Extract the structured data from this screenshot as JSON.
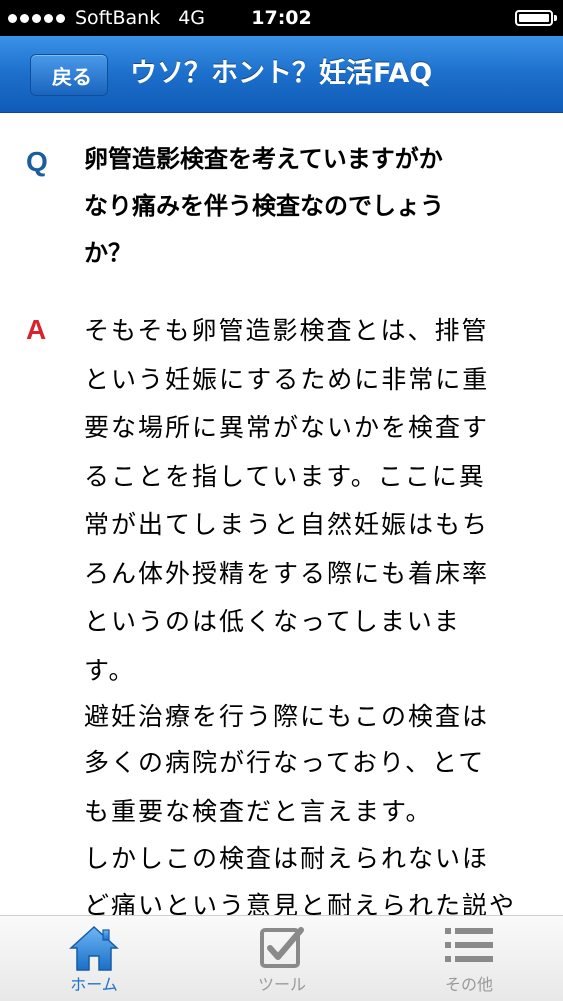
{
  "status_bar": {
    "carrier": "SoftBank",
    "network": "4G",
    "time": "17:02"
  },
  "navbar": {
    "back_label": "戻る",
    "title": "ウソ？ホント？妊活FAQ"
  },
  "qa": {
    "q_mark": "Q",
    "question_lines": [
      "卵管造影検査を考えていますがか",
      "なり痛みを伴う検査なのでしょう",
      "か？"
    ],
    "a_mark": "A",
    "answer_lines": [
      "そもそも卵管造影検査とは、排管",
      "という妊娠にするために非常に重",
      "要な場所に異常がないかを検査す",
      "ることを指しています。ここに異",
      "常が出てしまうと自然妊娠はもち",
      "ろん体外授精をする際にも着床率",
      "というのは低くなってしまいま",
      "す。",
      "避妊治療を行う際にもこの検査は",
      "多くの病院が行なっており、とて",
      "も重要な検査だと言えます。",
      "しかしこの検査は耐えられないほ",
      "ど痛いという意見と耐えられた説や"
    ]
  },
  "tabbar": {
    "tabs": [
      {
        "label": "ホーム",
        "icon": "house-icon",
        "active": true
      },
      {
        "label": "ツール",
        "icon": "checkbox-icon",
        "active": false
      },
      {
        "label": "その他",
        "icon": "list-icon",
        "active": false
      }
    ]
  },
  "colors": {
    "nav_blue": "#1c6fcb",
    "q_mark": "#1a5e9e",
    "a_mark": "#d8232f",
    "active_tab": "#1f74c9",
    "inactive_tab": "#9a9a9a"
  }
}
